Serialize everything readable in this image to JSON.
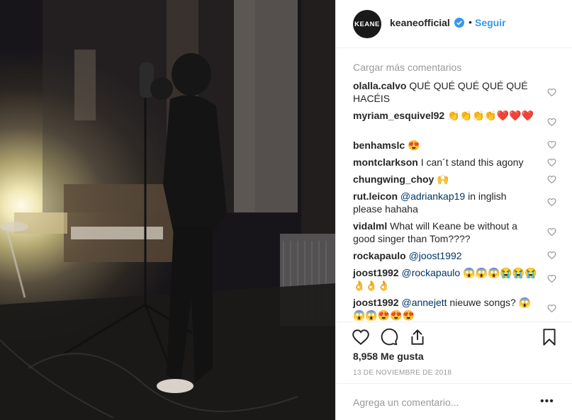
{
  "header": {
    "avatar_text": "KEANE",
    "username": "keaneofficial",
    "separator": "•",
    "follow_label": "Seguir"
  },
  "comments": {
    "load_more": "Cargar más comentarios",
    "items": [
      {
        "user": "olalla.calvo",
        "text": "QUÉ QUÉ QUÉ QUÉ QUÉ HACÉIS"
      },
      {
        "user": "myriam_esquivel92",
        "text": "👏👏👏👏❤️❤️❤️"
      },
      {
        "user": "benhamslc",
        "text": "😍"
      },
      {
        "user": "montclarkson",
        "text": "I can´t stand this agony"
      },
      {
        "user": "chungwing_choy",
        "text": "🙌"
      },
      {
        "user": "rut.leicon",
        "mention": "@adriankap19",
        "text": " in inglish please hahaha"
      },
      {
        "user": "vidalml",
        "text": "What will Keane be without a good singer than Tom????"
      },
      {
        "user": "rockapaulo",
        "mention": "@joost1992",
        "text": ""
      },
      {
        "user": "joost1992",
        "mention": "@rockapaulo",
        "text": " 😱😱😱😭😭😭👌👌👌"
      },
      {
        "user": "joost1992",
        "mention": "@annejett",
        "text": " nieuwe songs? 😱😱😱😍😍😍"
      }
    ]
  },
  "likes": "8,958 Me gusta",
  "date": "13 DE NOVIEMBRE DE 2018",
  "add_comment": {
    "placeholder": "Agrega un comentario...",
    "more": "•••"
  },
  "icons": [
    "heart-icon",
    "comment-icon",
    "share-icon",
    "bookmark-icon",
    "verified-icon",
    "small-heart-icon"
  ],
  "colors": {
    "accent": "#3897f0",
    "verified": "#3897f0",
    "muted": "#999999",
    "mention": "#003569"
  }
}
